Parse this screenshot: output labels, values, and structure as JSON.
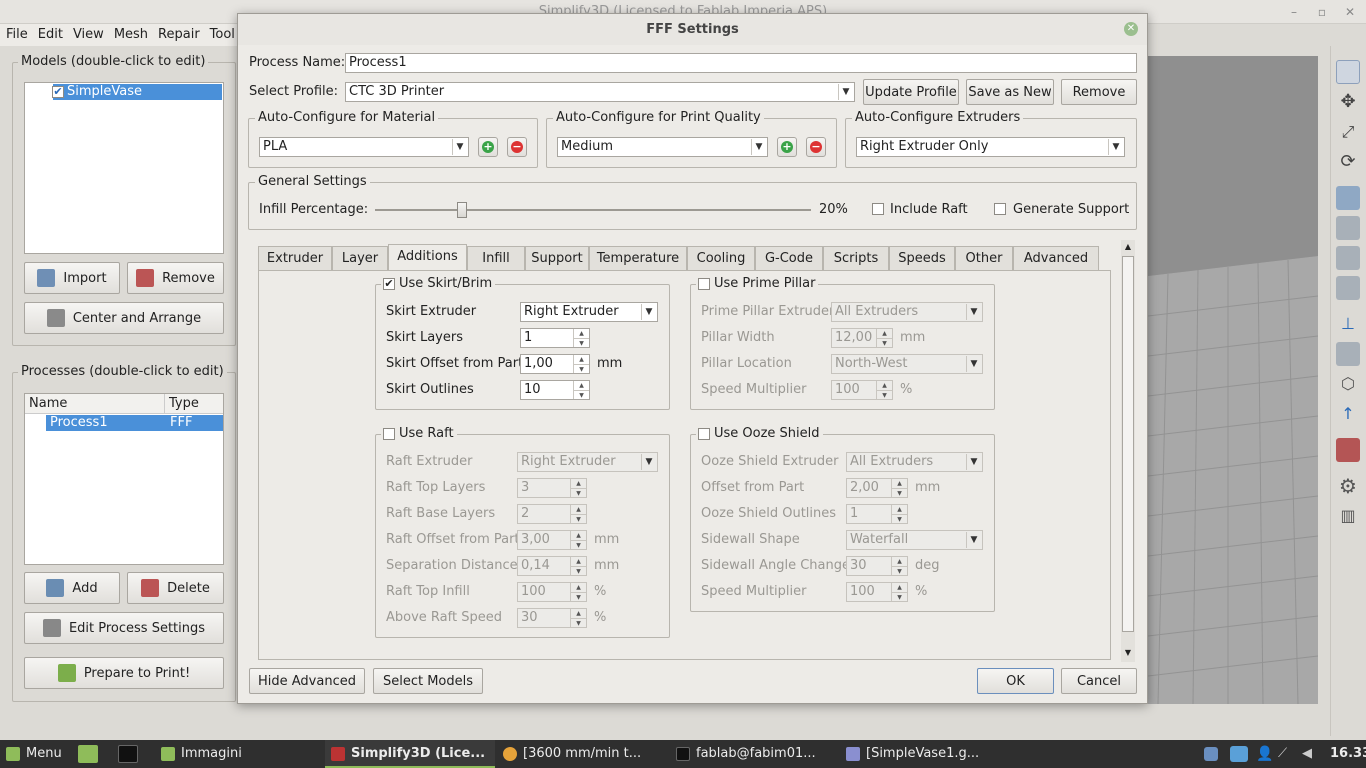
{
  "window": {
    "title": "Simplify3D (Licensed to Fablab Imperia APS)"
  },
  "menubar": [
    "File",
    "Edit",
    "View",
    "Mesh",
    "Repair",
    "Tool"
  ],
  "models": {
    "title": "Models (double-click to edit)",
    "items": [
      "SimpleVase"
    ],
    "import_label": "Import",
    "remove_label": "Remove",
    "center_label": "Center and Arrange"
  },
  "processes": {
    "title": "Processes (double-click to edit)",
    "columns": [
      "Name",
      "Type"
    ],
    "rows": [
      {
        "name": "Process1",
        "type": "FFF"
      }
    ],
    "add_label": "Add",
    "delete_label": "Delete",
    "edit_label": "Edit Process Settings",
    "prepare_label": "Prepare to Print!"
  },
  "dialog": {
    "title": "FFF Settings",
    "process_name_label": "Process Name:",
    "process_name": "Process1",
    "select_profile_label": "Select Profile:",
    "profile": "CTC 3D Printer",
    "update_profile": "Update Profile",
    "save_as_new": "Save as New",
    "remove": "Remove",
    "material": {
      "title": "Auto-Configure for Material",
      "value": "PLA"
    },
    "quality": {
      "title": "Auto-Configure for Print Quality",
      "value": "Medium"
    },
    "extruders": {
      "title": "Auto-Configure Extruders",
      "value": "Right Extruder Only"
    },
    "general": {
      "title": "General Settings",
      "infill_label": "Infill Percentage:",
      "infill_value": "20%",
      "infill_fraction": 0.2,
      "include_raft": "Include Raft",
      "generate_support": "Generate Support"
    },
    "tabs": [
      "Extruder",
      "Layer",
      "Additions",
      "Infill",
      "Support",
      "Temperature",
      "Cooling",
      "G-Code",
      "Scripts",
      "Speeds",
      "Other",
      "Advanced"
    ],
    "active_tab": "Additions",
    "skirt": {
      "title": "Use Skirt/Brim",
      "checked": true,
      "extruder_label": "Skirt Extruder",
      "extruder": "Right Extruder",
      "layers_label": "Skirt Layers",
      "layers": "1",
      "offset_label": "Skirt Offset from Part",
      "offset": "1,00",
      "offset_unit": "mm",
      "outlines_label": "Skirt Outlines",
      "outlines": "10"
    },
    "prime": {
      "title": "Use Prime Pillar",
      "extruder_label": "Prime Pillar Extruder",
      "extruder": "All Extruders",
      "width_label": "Pillar Width",
      "width": "12,00",
      "width_unit": "mm",
      "location_label": "Pillar Location",
      "location": "North-West",
      "speed_label": "Speed Multiplier",
      "speed": "100",
      "speed_unit": "%"
    },
    "raft": {
      "title": "Use Raft",
      "extruder_label": "Raft Extruder",
      "extruder": "Right Extruder",
      "top_layers_label": "Raft Top Layers",
      "top_layers": "3",
      "base_layers_label": "Raft Base Layers",
      "base_layers": "2",
      "offset_label": "Raft Offset from Part",
      "offset": "3,00",
      "offset_unit": "mm",
      "separation_label": "Separation Distance",
      "separation": "0,14",
      "separation_unit": "mm",
      "top_infill_label": "Raft Top Infill",
      "top_infill": "100",
      "top_infill_unit": "%",
      "above_speed_label": "Above Raft Speed",
      "above_speed": "30",
      "above_speed_unit": "%"
    },
    "ooze": {
      "title": "Use Ooze Shield",
      "extruder_label": "Ooze Shield Extruder",
      "extruder": "All Extruders",
      "offset_label": "Offset from Part",
      "offset": "2,00",
      "offset_unit": "mm",
      "outlines_label": "Ooze Shield Outlines",
      "outlines": "1",
      "sidewall_label": "Sidewall Shape",
      "sidewall": "Waterfall",
      "angle_label": "Sidewall Angle Change",
      "angle": "30",
      "angle_unit": "deg",
      "speed_label": "Speed Multiplier",
      "speed": "100",
      "speed_unit": "%"
    },
    "hide_advanced": "Hide Advanced",
    "select_models": "Select Models",
    "ok": "OK",
    "cancel": "Cancel"
  },
  "taskbar": {
    "menu": "Menu",
    "tasks": [
      "Immagini",
      "Simplify3D (Lice...",
      "[3600 mm/min t...",
      "fablab@fabim01...",
      "[SimpleVase1.g..."
    ],
    "clock": "16.33"
  }
}
